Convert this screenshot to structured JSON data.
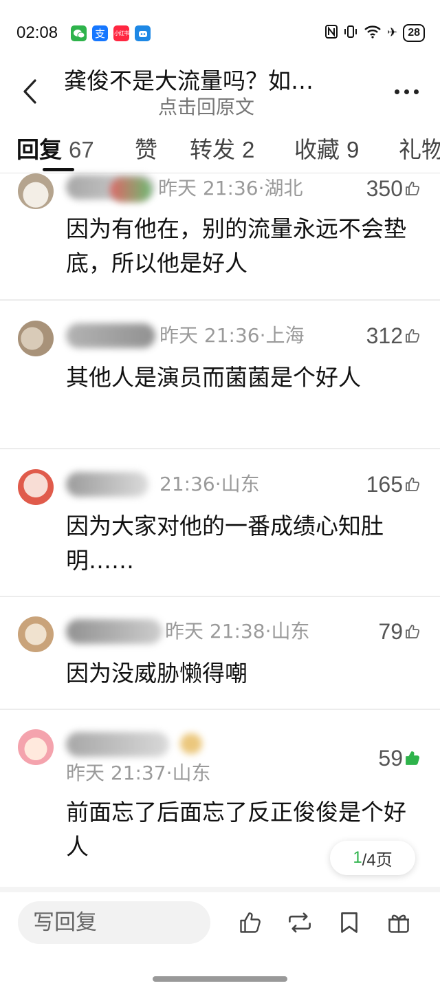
{
  "status_bar": {
    "time": "02:08",
    "app_icons": [
      {
        "name": "wechat-icon",
        "glyph": "✆",
        "color": "#2eb34b"
      },
      {
        "name": "alipay-icon",
        "glyph": "支",
        "color": "#1677ff"
      },
      {
        "name": "xiaohongshu-icon",
        "glyph": "小红书",
        "color": "#ff2741"
      },
      {
        "name": "app-icon",
        "glyph": "◉",
        "color": "#1e88e5"
      }
    ],
    "battery": "28"
  },
  "header": {
    "title": "龚俊不是大流量吗？如…",
    "subtitle": "点击回原文"
  },
  "tabs": [
    {
      "label": "回复",
      "count": "67",
      "active": true
    },
    {
      "label": "赞",
      "count": "",
      "active": false
    },
    {
      "label": "转发",
      "count": "2",
      "active": false
    },
    {
      "label": "收藏",
      "count": "9",
      "active": false
    },
    {
      "label": "礼物",
      "count": "",
      "active": false
    }
  ],
  "comments": [
    {
      "time": "昨天 21:36",
      "location": "湖北",
      "likes": "350",
      "liked": false,
      "text": "因为有他在，别的流量永远不会垫底，所以他是好人"
    },
    {
      "time": "昨天 21:36",
      "location": "上海",
      "likes": "312",
      "liked": false,
      "text": "其他人是演员而菌菌是个好人"
    },
    {
      "time": "21:36",
      "location": "山东",
      "likes": "165",
      "liked": false,
      "text": "因为大家对他的一番成绩心知肚明……"
    },
    {
      "time": "昨天 21:38",
      "location": "山东",
      "likes": "79",
      "liked": false,
      "text": "因为没威胁懒得嘲"
    },
    {
      "time": "昨天 21:37",
      "location": "山东",
      "likes": "59",
      "liked": true,
      "text": "前面忘了后面忘了反正俊俊是个好人"
    }
  ],
  "pager": {
    "current": "1",
    "total": "/4页"
  },
  "bottom_bar": {
    "reply_placeholder": "写回复",
    "actions": [
      "like-icon",
      "repost-icon",
      "bookmark-icon",
      "gift-icon"
    ]
  },
  "colors": {
    "accent_green": "#2eb34b",
    "meta_gray": "#9a9a9a"
  }
}
